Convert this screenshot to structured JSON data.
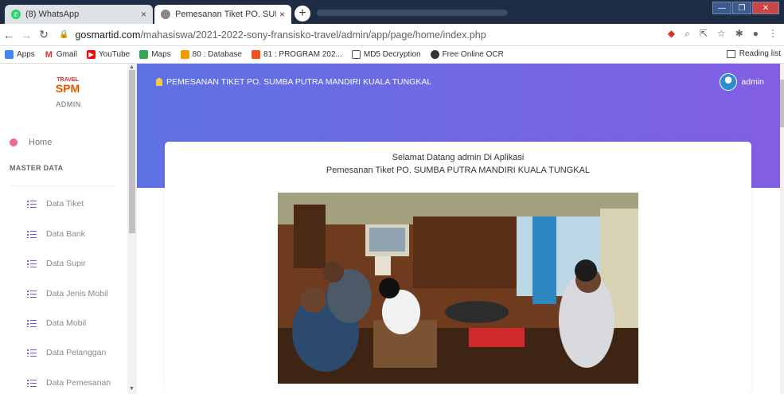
{
  "browser": {
    "tabs": [
      {
        "label": "(8) WhatsApp",
        "close": "×"
      },
      {
        "label": "Pemesanan Tiket PO. SUMBA PU",
        "close": "×"
      }
    ],
    "new_tab": "+",
    "url_host": "gosmartid.com",
    "url_path": "/mahasiswa/2021-2022-sony-fransisko-travel/admin/app/page/home/index.php",
    "bookmarks": [
      {
        "label": "Apps",
        "icon": "apps-icon",
        "color": "#4285f4"
      },
      {
        "label": "Gmail",
        "icon": "gmail-icon",
        "color": "#d93025"
      },
      {
        "label": "YouTube",
        "icon": "youtube-icon",
        "color": "#ff0000"
      },
      {
        "label": "Maps",
        "icon": "maps-icon",
        "color": "#34a853"
      },
      {
        "label": "80 : Database",
        "icon": "database-icon",
        "color": "#f29900"
      },
      {
        "label": "81 : PROGRAM 202...",
        "icon": "program-icon",
        "color": "#f4511e"
      },
      {
        "label": "MD5 Decryption",
        "icon": "lock-icon",
        "color": "#555555"
      },
      {
        "label": "Free Online OCR",
        "icon": "ocr-icon",
        "color": "#333333"
      }
    ],
    "reading_list": "Reading list"
  },
  "sidebar": {
    "logo_text": "SPM TRAVEL",
    "admin_label": "ADMIN",
    "home": "Home",
    "section": "MASTER DATA",
    "items": [
      {
        "label": "Data Tiket"
      },
      {
        "label": "Data Bank"
      },
      {
        "label": "Data Supir"
      },
      {
        "label": "Data Jenis Mobil"
      },
      {
        "label": "Data Mobil"
      },
      {
        "label": "Data Pelanggan"
      },
      {
        "label": "Data Pemesanan"
      }
    ]
  },
  "header": {
    "title": "PEMESANAN TIKET PO. SUMBA PUTRA MANDIRI KUALA TUNGKAL",
    "user": "admin",
    "gradient_start": "#5e72e4",
    "gradient_end": "#825ee4"
  },
  "main": {
    "welcome_line1": "Selamat Datang admin Di Aplikasi",
    "welcome_line2": "Pemesanan Tiket PO. SUMBA PUTRA MANDIRI KUALA TUNGKAL"
  }
}
